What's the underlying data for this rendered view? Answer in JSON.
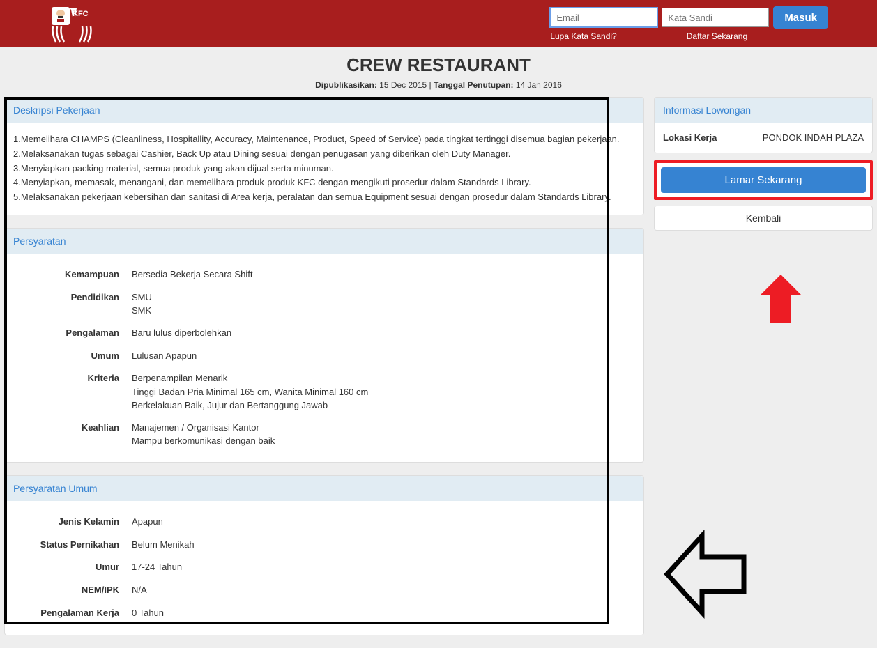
{
  "header": {
    "brand": "KFC",
    "email_placeholder": "Email",
    "password_placeholder": "Kata Sandi",
    "login": "Masuk",
    "forgot": "Lupa Kata Sandi?",
    "register": "Daftar Sekarang"
  },
  "title": "CREW RESTAURANT",
  "meta": {
    "pub_label": "Dipublikasikan:",
    "pub_date": "15 Dec 2015",
    "close_label": "Tanggal Penutupan:",
    "close_date": "14 Jan 2016"
  },
  "sections": {
    "desc": {
      "title": "Deskripsi Pekerjaan",
      "body": "1.Memelihara CHAMPS (Cleanliness, Hospitallity, Accuracy, Maintenance, Product, Speed of Service) pada tingkat tertinggi disemua bagian pekerjaan.\n2.Melaksanakan tugas sebagai Cashier, Back Up atau Dining sesuai dengan penugasan yang diberikan oleh Duty Manager.\n3.Menyiapkan packing material, semua produk yang akan dijual serta minuman.\n4.Menyiapkan, memasak, menangani, dan memelihara produk-produk KFC dengan mengikuti prosedur dalam Standards Library.\n5.Melaksanakan pekerjaan kebersihan dan sanitasi di Area kerja, peralatan dan semua Equipment sesuai dengan prosedur dalam Standards Library."
    },
    "req": {
      "title": "Persyaratan",
      "rows": [
        {
          "label": "Kemampuan",
          "value": "Bersedia Bekerja Secara Shift"
        },
        {
          "label": "Pendidikan",
          "value": "SMU\nSMK"
        },
        {
          "label": "Pengalaman",
          "value": "Baru lulus diperbolehkan"
        },
        {
          "label": "Umum",
          "value": "Lulusan Apapun"
        },
        {
          "label": "Kriteria",
          "value": "Berpenampilan Menarik\nTinggi Badan Pria Minimal 165 cm, Wanita Minimal 160 cm\nBerkelakuan Baik, Jujur dan Bertanggung Jawab"
        },
        {
          "label": "Keahlian",
          "value": "Manajemen / Organisasi Kantor\nMampu berkomunikasi dengan baik"
        }
      ]
    },
    "gen": {
      "title": "Persyaratan Umum",
      "rows": [
        {
          "label": "Jenis Kelamin",
          "value": "Apapun"
        },
        {
          "label": "Status Pernikahan",
          "value": "Belum Menikah"
        },
        {
          "label": "Umur",
          "value": "17-24 Tahun"
        },
        {
          "label": "NEM/IPK",
          "value": "N/A"
        },
        {
          "label": "Pengalaman Kerja",
          "value": "0 Tahun"
        }
      ]
    }
  },
  "info": {
    "title": "Informasi Lowongan",
    "loc_label": "Lokasi Kerja",
    "loc_value": "PONDOK INDAH PLAZA"
  },
  "actions": {
    "apply": "Lamar Sekarang",
    "back": "Kembali"
  }
}
